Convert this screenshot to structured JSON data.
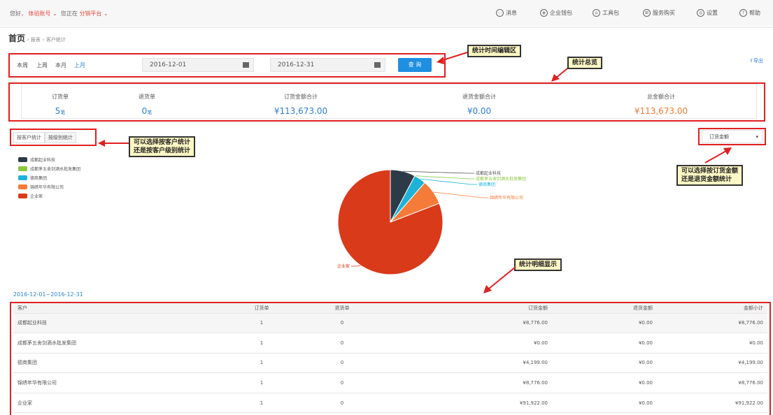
{
  "topbar": {
    "greeting": "您好，",
    "account": "体验账号",
    "at_label": "您正在",
    "platform": "分销平台",
    "nav": [
      {
        "label": "消息",
        "icon": "message-icon",
        "glyph": "⋯"
      },
      {
        "label": "企业钱包",
        "icon": "wallet-icon",
        "glyph": "◈"
      },
      {
        "label": "工具包",
        "icon": "toolkit-icon",
        "glyph": "⌂"
      },
      {
        "label": "服务购买",
        "icon": "service-icon",
        "glyph": "⊞"
      },
      {
        "label": "设置",
        "icon": "settings-icon",
        "glyph": "◎"
      },
      {
        "label": "帮助",
        "icon": "help-icon",
        "glyph": "?"
      }
    ]
  },
  "breadcrumb": {
    "home": "首页",
    "sep1": "›",
    "section": "报表",
    "sep2": "›",
    "page": "客户统计"
  },
  "filter": {
    "quick": [
      "本周",
      "上周",
      "本月",
      "上月"
    ],
    "start_date": "2016-12-01",
    "end_date": "2016-12-31",
    "query_label": "查 询",
    "export_label": "导出"
  },
  "summary": {
    "order_count_label": "订货单",
    "order_count": "5",
    "order_count_unit": "笔",
    "return_count_label": "退货单",
    "return_count": "0",
    "return_count_unit": "笔",
    "order_amount_label": "订货金额合计",
    "order_amount": "¥113,673.00",
    "return_amount_label": "退货金额合计",
    "return_amount": "¥0.00",
    "total_amount_label": "总金额合计",
    "total_amount": "¥113,673.00"
  },
  "tabs": [
    "按客户统计",
    "按级别统计"
  ],
  "metric_select": {
    "selected": "订货金额"
  },
  "legend": [
    {
      "name": "成都起业科技",
      "color": "#2d3a47"
    },
    {
      "name": "成都茅五舍剑酒水批发集团",
      "color": "#8dc63f"
    },
    {
      "name": "德商集团",
      "color": "#1db3d9"
    },
    {
      "name": "锦绣年华有限公司",
      "color": "#f47c38"
    },
    {
      "name": "企业家",
      "color": "#d93a1a"
    }
  ],
  "chart_data": {
    "type": "pie",
    "title": "",
    "labels": [
      "成都起业科技",
      "成都茅五舍剑酒水批发集团",
      "德商集团",
      "锦绣年华有限公司",
      "企业家"
    ],
    "values": [
      8776,
      0,
      4199,
      8776,
      91922
    ],
    "colors": [
      "#2d3a47",
      "#8dc63f",
      "#1db3d9",
      "#f47c38",
      "#d93a1a"
    ]
  },
  "annotations": {
    "time": "统计时间编辑区",
    "overview": "统计总览",
    "by_customer": [
      "可以选择按客户统计",
      "还是按客户级别统计"
    ],
    "by_amount": [
      "可以选择按订货金额",
      "还是退货金额统计"
    ],
    "detail": "统计明细显示"
  },
  "detail": {
    "range": "2016-12-01~2016-12-31",
    "columns": [
      "客户",
      "订货单",
      "退货单",
      "订货金额",
      "退货金额",
      "金额小计"
    ],
    "rows": [
      [
        "成都起业科技",
        "1",
        "0",
        "¥8,776.00",
        "¥0.00",
        "¥8,776.00"
      ],
      [
        "成都茅五舍剑酒水批发集团",
        "1",
        "0",
        "¥0.00",
        "¥0.00",
        "¥0.00"
      ],
      [
        "德商集团",
        "1",
        "0",
        "¥4,199.00",
        "¥0.00",
        "¥4,199.00"
      ],
      [
        "锦绣年华有限公司",
        "1",
        "0",
        "¥8,776.00",
        "¥0.00",
        "¥8,776.00"
      ],
      [
        "企业家",
        "1",
        "0",
        "¥91,922.00",
        "¥0.00",
        "¥91,922.00"
      ]
    ]
  }
}
